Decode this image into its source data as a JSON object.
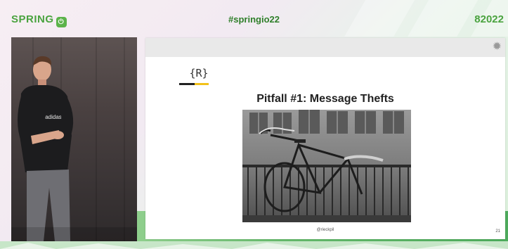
{
  "header": {
    "brand_text": "SPRING",
    "brand_logo_glyph": "IO",
    "hashtag": "#springio22",
    "year": "2022",
    "year_prefix": "8"
  },
  "slide": {
    "logo_text": "{R}",
    "title": "Pitfall #1: Message Thefts",
    "credit": "@rieckpil",
    "page_number": "21",
    "settings_icon": "gear-icon"
  },
  "colors": {
    "brand_green": "#4aa33f",
    "hashtag_green": "#2f7f2a",
    "accent_yellow": "#f2c11a"
  }
}
